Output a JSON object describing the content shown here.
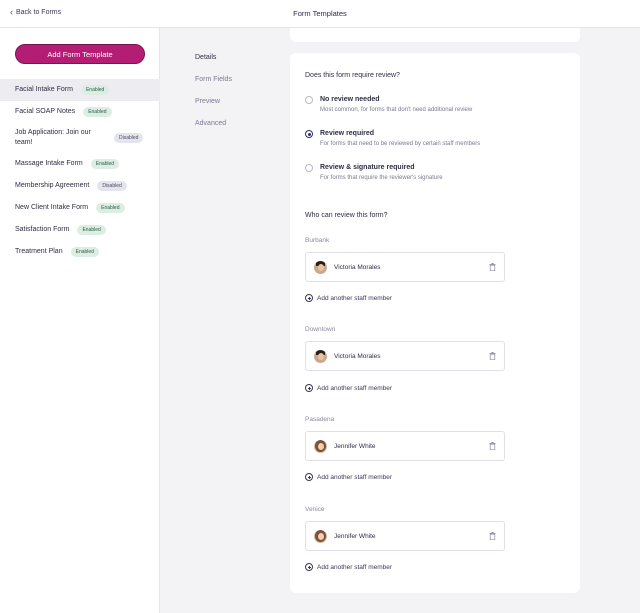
{
  "header": {
    "back_label": "Back to Forms",
    "title": "Form Templates"
  },
  "sidebar": {
    "add_button": "Add Form Template",
    "items": [
      {
        "label": "Facial Intake Form",
        "status": "Enabled"
      },
      {
        "label": "Facial SOAP Notes",
        "status": "Enabled"
      },
      {
        "label": "Job Application: Join our team!",
        "status": "Disabled"
      },
      {
        "label": "Massage Intake Form",
        "status": "Enabled"
      },
      {
        "label": "Membership Agreement",
        "status": "Disabled"
      },
      {
        "label": "New Client Intake Form",
        "status": "Enabled"
      },
      {
        "label": "Satisfaction Form",
        "status": "Enabled"
      },
      {
        "label": "Treatment Plan",
        "status": "Enabled"
      }
    ]
  },
  "subnav": [
    "Details",
    "Form Fields",
    "Preview",
    "Advanced"
  ],
  "review": {
    "question": "Does this form require review?",
    "options": [
      {
        "title": "No review needed",
        "desc": "Most common, for forms that don't need additional review"
      },
      {
        "title": "Review required",
        "desc": "For forms that need to be reviewed by certain staff members"
      },
      {
        "title": "Review & signature required",
        "desc": "For forms that require the reviewer's signature"
      }
    ],
    "selected_option": "Review required",
    "who_question": "Who can review this form?"
  },
  "locations": [
    {
      "name": "Burbank",
      "staff": "Victoria Morales"
    },
    {
      "name": "Downtown",
      "staff": "Victoria Morales"
    },
    {
      "name": "Pasadena",
      "staff": "Jennifer White"
    },
    {
      "name": "Venice",
      "staff": "Jennifer White"
    }
  ],
  "add_staff_label": "Add another staff member",
  "colors": {
    "accent": "#b31d74",
    "enabled_badge": "#dceee4",
    "disabled_badge": "#e4e4ec",
    "selected_radio": "#2e2e6a"
  }
}
